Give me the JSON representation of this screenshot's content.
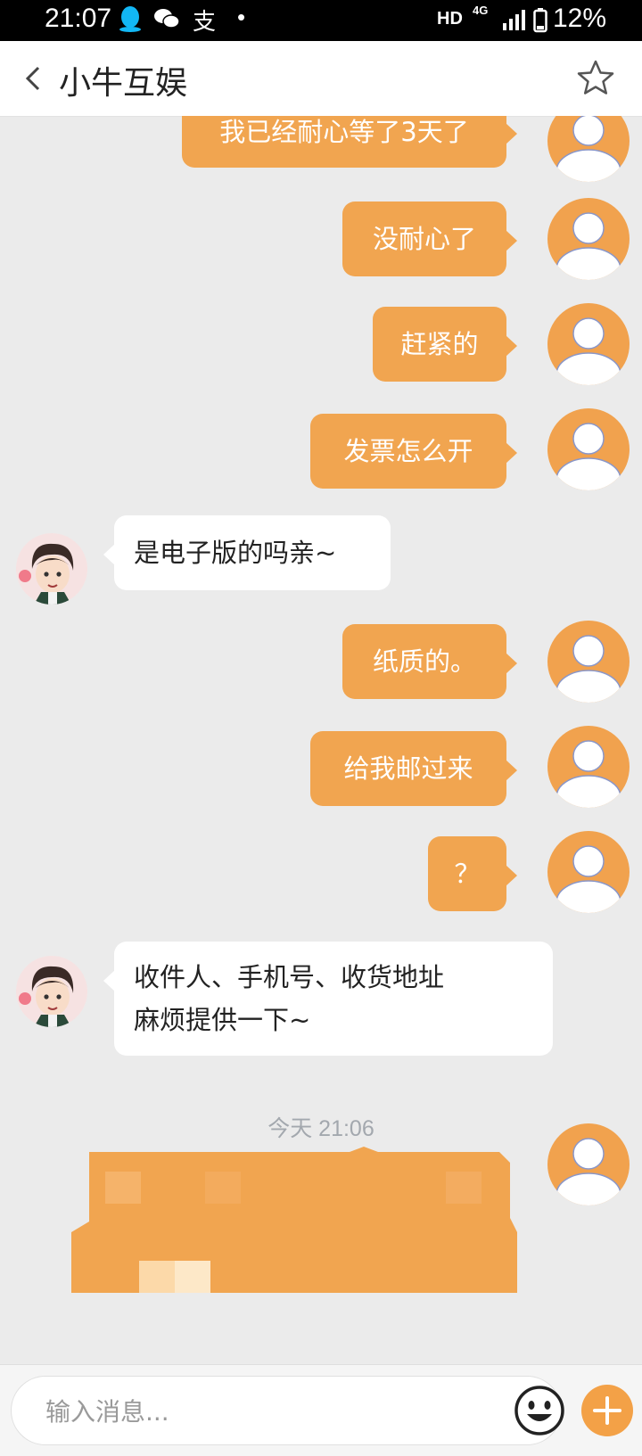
{
  "status_bar": {
    "time": "21:07",
    "alipay_glyph": "支",
    "dot": "•",
    "hd": "HD",
    "network": "4G",
    "battery": "12%"
  },
  "header": {
    "back_icon": "chevron-left-icon",
    "title": "小牛互娱",
    "favorite_icon": "star-outline-icon"
  },
  "messages": [
    {
      "from": "me",
      "text": "我已经耐心等了3天了"
    },
    {
      "from": "me",
      "text": "没耐心了"
    },
    {
      "from": "me",
      "text": "赶紧的"
    },
    {
      "from": "me",
      "text": "发票怎么开"
    },
    {
      "from": "agent",
      "text": "是电子版的吗亲~"
    },
    {
      "from": "me",
      "text": "纸质的。"
    },
    {
      "from": "me",
      "text": "给我邮过来"
    },
    {
      "from": "me",
      "text": "？"
    },
    {
      "from": "agent",
      "lines": [
        "收件人、手机号、收货地址",
        "麻烦提供一下~"
      ]
    }
  ],
  "timestamp": "今天 21:06",
  "input": {
    "placeholder": "输入消息...",
    "emoji_icon": "emoji-icon",
    "plus_icon": "plus-icon"
  },
  "colors": {
    "accent": "#f1a550",
    "background": "#ebebeb",
    "timestamp": "#a3a8ae"
  }
}
